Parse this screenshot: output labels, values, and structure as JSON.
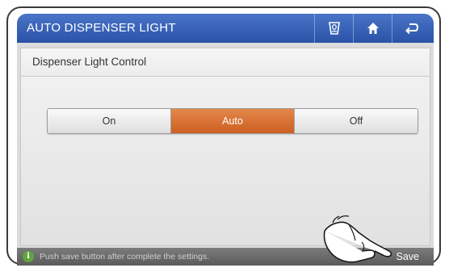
{
  "header": {
    "title": "AUTO DISPENSER LIGHT",
    "buttons": [
      {
        "name": "dispenser-icon"
      },
      {
        "name": "home-icon"
      },
      {
        "name": "back-icon"
      }
    ]
  },
  "panel": {
    "title": "Dispenser Light Control",
    "options": [
      {
        "label": "On",
        "selected": false
      },
      {
        "label": "Auto",
        "selected": true
      },
      {
        "label": "Off",
        "selected": false
      }
    ]
  },
  "footer": {
    "message": "Push save button after complete the settings.",
    "save_label": "Save"
  },
  "colors": {
    "titlebar": "#2f5bb0",
    "selected_option": "#d96c2f",
    "info_icon": "#5fa43c"
  }
}
